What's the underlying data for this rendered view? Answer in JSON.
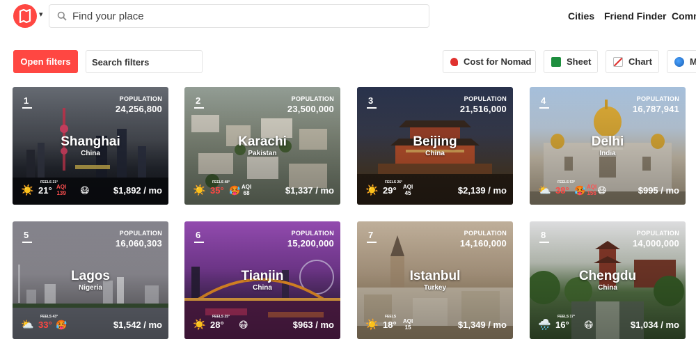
{
  "header": {
    "search_placeholder": "Find your place",
    "nav": [
      "Cities",
      "Friend Finder",
      "Comm"
    ]
  },
  "filters": {
    "open_label": "Open filters",
    "search_label": "Search filters",
    "tools": [
      {
        "label": "Cost for Nomad",
        "icon": "price-tag-icon"
      },
      {
        "label": "Sheet",
        "icon": "spreadsheet-icon"
      },
      {
        "label": "Chart",
        "icon": "chart-icon"
      },
      {
        "label": "M",
        "icon": "globe-icon"
      }
    ]
  },
  "population_label": "POPULATION",
  "feels_prefix": "FEELS",
  "aqi_label": "AQI",
  "cities": [
    {
      "rank": "1",
      "name": "Shanghai",
      "country": "China",
      "population": "24,256,800",
      "temp": "21°",
      "feels": "FEELS 21°",
      "aqi": "139",
      "aqi_bad": true,
      "weather": "sun",
      "face": "😷",
      "cost": "$1,892 / mo",
      "hot": false
    },
    {
      "rank": "2",
      "name": "Karachi",
      "country": "Pakistan",
      "population": "23,500,000",
      "temp": "35°",
      "feels": "FEELS 48°",
      "aqi": "68",
      "aqi_bad": false,
      "weather": "sun",
      "face": "🥵",
      "cost": "$1,337 / mo",
      "hot": true
    },
    {
      "rank": "3",
      "name": "Beijing",
      "country": "China",
      "population": "21,516,000",
      "temp": "29°",
      "feels": "FEELS 26°",
      "aqi": "45",
      "aqi_bad": false,
      "weather": "sun",
      "face": "",
      "cost": "$2,139 / mo",
      "hot": false
    },
    {
      "rank": "4",
      "name": "Delhi",
      "country": "India",
      "population": "16,787,941",
      "temp": "38°",
      "feels": "FEELS 53°",
      "aqi": "156",
      "aqi_bad": true,
      "weather": "cloud",
      "face": "😷",
      "cost": "$995 / mo",
      "hot": true
    },
    {
      "rank": "5",
      "name": "Lagos",
      "country": "Nigeria",
      "population": "16,060,303",
      "temp": "33°",
      "feels": "FEELS 43°",
      "aqi": "",
      "aqi_bad": false,
      "weather": "cloud",
      "face": "🥵",
      "cost": "$1,542 / mo",
      "hot": true
    },
    {
      "rank": "6",
      "name": "Tianjin",
      "country": "China",
      "population": "15,200,000",
      "temp": "28°",
      "feels": "FEELS 25°",
      "aqi": "",
      "aqi_bad": false,
      "weather": "sun",
      "face": "😷",
      "cost": "$963 / mo",
      "hot": false
    },
    {
      "rank": "7",
      "name": "Istanbul",
      "country": "Turkey",
      "population": "14,160,000",
      "temp": "18°",
      "feels": "FEELS",
      "aqi": "15",
      "aqi_bad": false,
      "weather": "sun",
      "face": "",
      "cost": "$1,349 / mo",
      "hot": false
    },
    {
      "rank": "8",
      "name": "Chengdu",
      "country": "China",
      "population": "14,000,000",
      "temp": "16°",
      "feels": "FEELS 17°",
      "aqi": "",
      "aqi_bad": false,
      "weather": "rain",
      "face": "😷",
      "cost": "$1,034 / mo",
      "hot": false
    }
  ],
  "colors": {
    "accent": "#ff4742",
    "hot_temp": "#ff4742",
    "bad_aqi": "#ff5050"
  }
}
